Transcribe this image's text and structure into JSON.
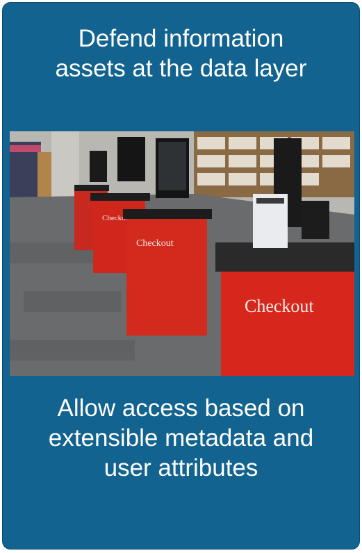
{
  "card": {
    "heading_lines": [
      "Defend information",
      "assets at the data layer"
    ],
    "caption_lines": [
      "Allow access based on",
      "extensible metadata and",
      "user attributes"
    ]
  },
  "photo": {
    "desc": "library self-checkout kiosks",
    "sign_label_large": "Checkout",
    "sign_label_mid": "Checkout",
    "sign_label_small": "Checkout"
  },
  "colors": {
    "card_bg": "#12638f",
    "text": "#ffffff",
    "kiosk_red": "#d7261c"
  }
}
